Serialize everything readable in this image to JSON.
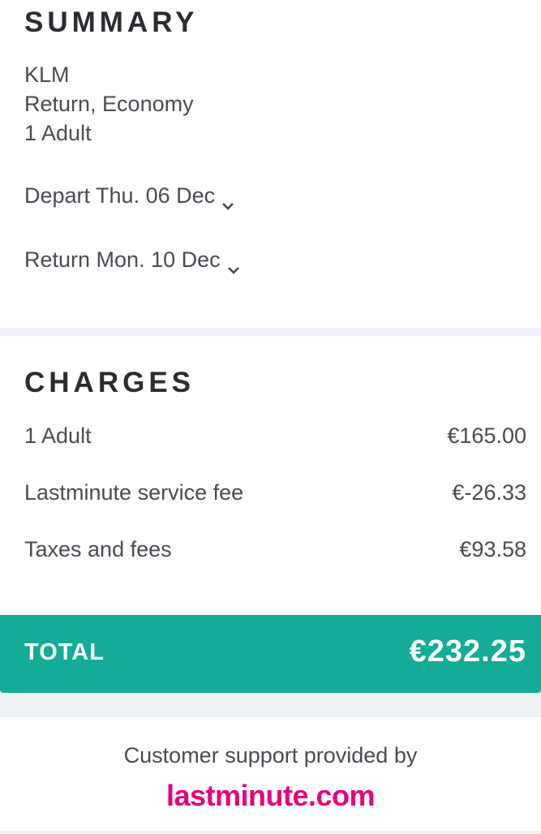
{
  "summary": {
    "title": "SUMMARY",
    "airline": "KLM",
    "trip_type": "Return, Economy",
    "passengers": "1 Adult",
    "depart_label": "Depart Thu. 06 Dec",
    "return_label": "Return Mon. 10 Dec"
  },
  "charges": {
    "title": "CHARGES",
    "rows": [
      {
        "label": "1 Adult",
        "amount": "€165.00"
      },
      {
        "label": "Lastminute service fee",
        "amount": "€-26.33"
      },
      {
        "label": "Taxes and fees",
        "amount": "€93.58"
      }
    ]
  },
  "total": {
    "label": "TOTAL",
    "amount": "€232.25"
  },
  "support": {
    "text": "Customer support provided by",
    "brand": "lastminute.com"
  },
  "colors": {
    "total_bar": "#13ac98",
    "brand": "#e5007e"
  },
  "icons": {
    "expand": "chevron-down-icon"
  }
}
